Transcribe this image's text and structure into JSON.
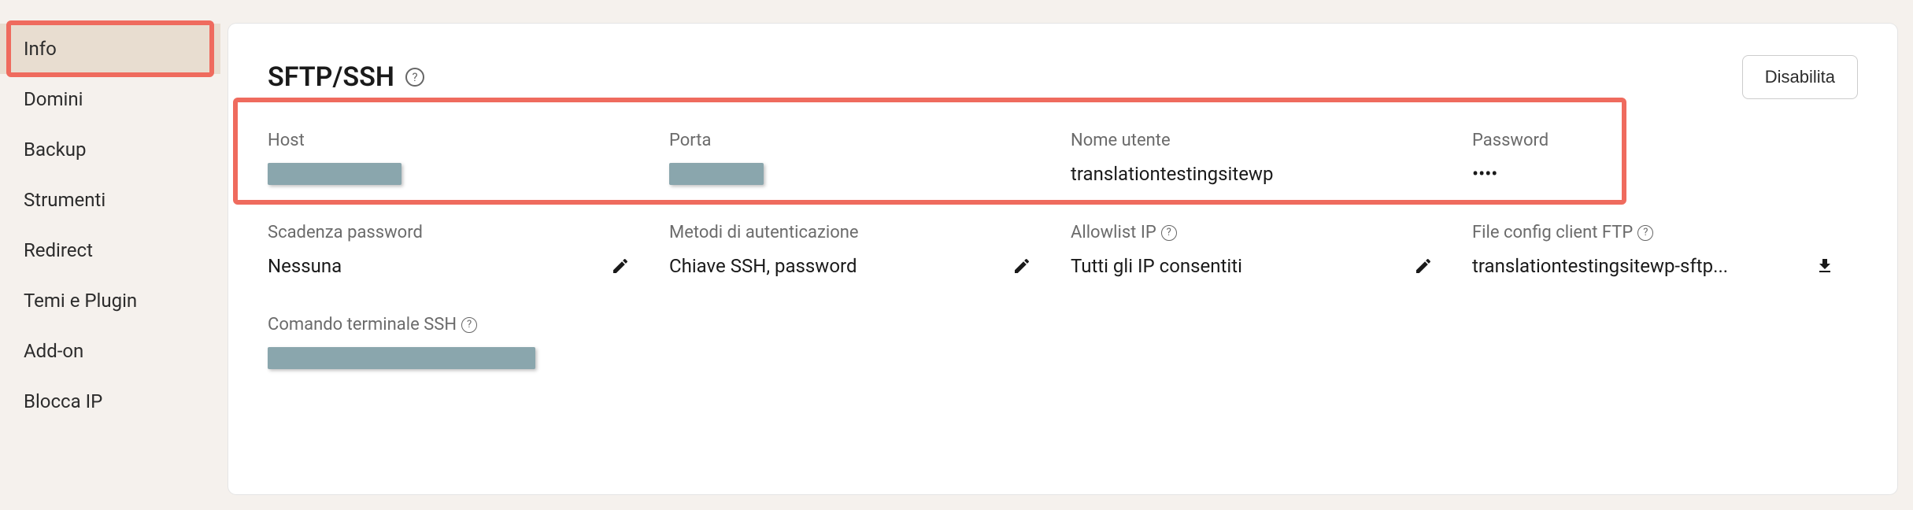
{
  "sidebar": {
    "items": [
      {
        "label": "Info"
      },
      {
        "label": "Domini"
      },
      {
        "label": "Backup"
      },
      {
        "label": "Strumenti"
      },
      {
        "label": "Redirect"
      },
      {
        "label": "Temi e Plugin"
      },
      {
        "label": "Add-on"
      },
      {
        "label": "Blocca IP"
      }
    ]
  },
  "panel": {
    "title": "SFTP/SSH",
    "disable_label": "Disabilita"
  },
  "fields": {
    "host_label": "Host",
    "port_label": "Porta",
    "username_label": "Nome utente",
    "username_value": "translationtestingsitewp",
    "password_label": "Password",
    "password_value": "••••",
    "pw_expiry_label": "Scadenza password",
    "pw_expiry_value": "Nessuna",
    "auth_methods_label": "Metodi di autenticazione",
    "auth_methods_value": "Chiave SSH, password",
    "allowlist_label": "Allowlist IP",
    "allowlist_value": "Tutti gli IP consentiti",
    "ftp_config_label": "File config client FTP",
    "ftp_config_value": "translationtestingsitewp-sftp...",
    "ssh_cmd_label": "Comando terminale SSH"
  }
}
